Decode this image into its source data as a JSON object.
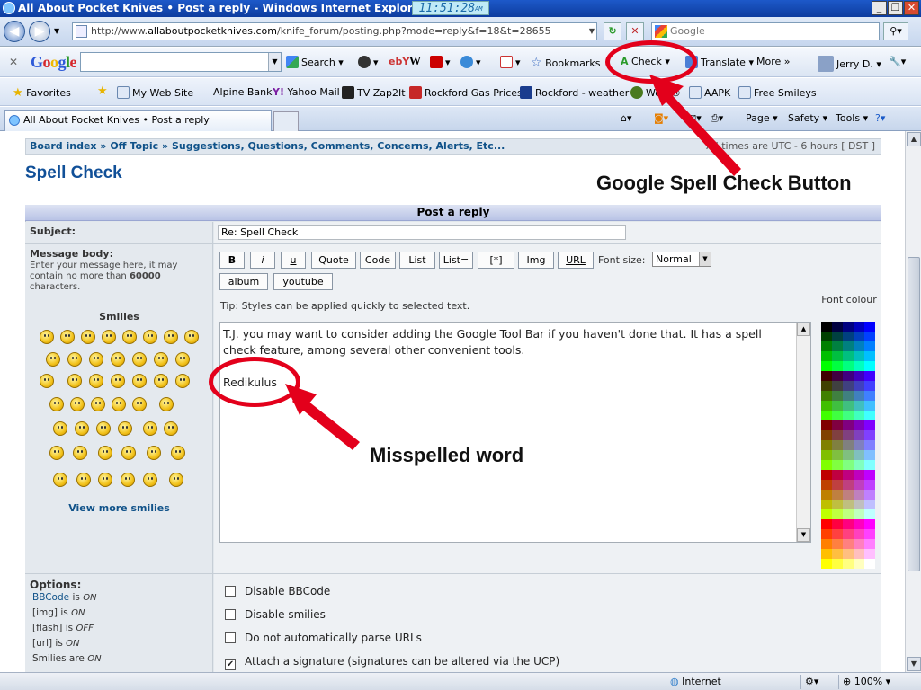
{
  "window": {
    "title": "All About Pocket Knives • Post a reply - Windows Internet Explorer",
    "clock": "11:51:28",
    "clock_suffix": "AM"
  },
  "address_bar": {
    "url_prefix": "http://www.",
    "url_host": "allaboutpocketknives.com",
    "url_path": "/knife_forum/posting.php?mode=reply&f=18&t=28655",
    "search_placeholder": "Google"
  },
  "google_toolbar": {
    "close_glyph": "✕",
    "logo": "Google",
    "search_label": "Search",
    "bookmarks_label": "Bookmarks",
    "check_label": "Check",
    "translate_label": "Translate",
    "more_label": "More »",
    "user_label": "Jerry D.",
    "w_glyph": "W",
    "ebay_glyph": "ebY"
  },
  "favorites_bar": {
    "favorites_label": "Favorites",
    "items": [
      "My Web Site",
      "Alpine Bank",
      "Yahoo Mail",
      "TV Zap2It",
      "Rockford Gas Prices",
      "Rockford - weather",
      "Woot®",
      "AAPK",
      "Free Smileys"
    ]
  },
  "tabs": {
    "active_tab": "All About Pocket Knives • Post a reply",
    "page_menu": "Page",
    "safety_menu": "Safety",
    "tools_menu": "Tools"
  },
  "breadcrumb": {
    "items": [
      "Board index",
      "Off Topic",
      "Suggestions, Questions, Comments, Concerns, Alerts, Etc..."
    ],
    "separator": "»",
    "time_info": "All times are UTC - 6 hours [ DST ]"
  },
  "page_title": "Spell Check",
  "form": {
    "header": "Post a reply",
    "subject_label": "Subject:",
    "subject_value": "Re: Spell Check",
    "message_label": "Message body:",
    "message_hint_1": "Enter your message here, it may",
    "message_hint_2": "contain no more than",
    "message_hint_limit": "60000",
    "message_hint_3": "characters.",
    "bbcode_buttons": [
      "B",
      "i",
      "u",
      "Quote",
      "Code",
      "List",
      "List=",
      "[*]",
      "Img",
      "URL"
    ],
    "bbcode_buttons_row2": [
      "album",
      "youtube"
    ],
    "font_size_label": "Font size:",
    "font_size_value": "Normal",
    "tip": "Tip: Styles can be applied quickly to selected text.",
    "message_text": "T.J. you may want to consider adding the Google Tool Bar if you haven't done that. It has a spell check feature, among several other convenient tools.\n\nRedikulus",
    "font_colour_label": "Font colour",
    "smilies_title": "Smilies",
    "view_more_smilies": "View more smilies",
    "options_title": "Options:",
    "options_status": [
      {
        "name": "BBCode",
        "state": "ON",
        "link": true
      },
      {
        "name": "[img]",
        "state": "ON",
        "link": false
      },
      {
        "name": "[flash]",
        "state": "OFF",
        "link": false
      },
      {
        "name": "[url]",
        "state": "ON",
        "link": false
      },
      {
        "name": "Smilies are",
        "state": "ON",
        "link": false
      }
    ],
    "is_word": "is",
    "checkboxes": [
      {
        "label": "Disable BBCode",
        "checked": false
      },
      {
        "label": "Disable smilies",
        "checked": false
      },
      {
        "label": "Do not automatically parse URLs",
        "checked": false
      },
      {
        "label": "Attach a signature (signatures can be altered via the UCP)",
        "checked": true
      }
    ]
  },
  "annotations": {
    "spell_check_button": "Google Spell Check Button",
    "misspelled_word": "Misspelled word",
    "color": "#e3001b"
  },
  "status_bar": {
    "zone": "Internet",
    "zoom": "100%"
  }
}
